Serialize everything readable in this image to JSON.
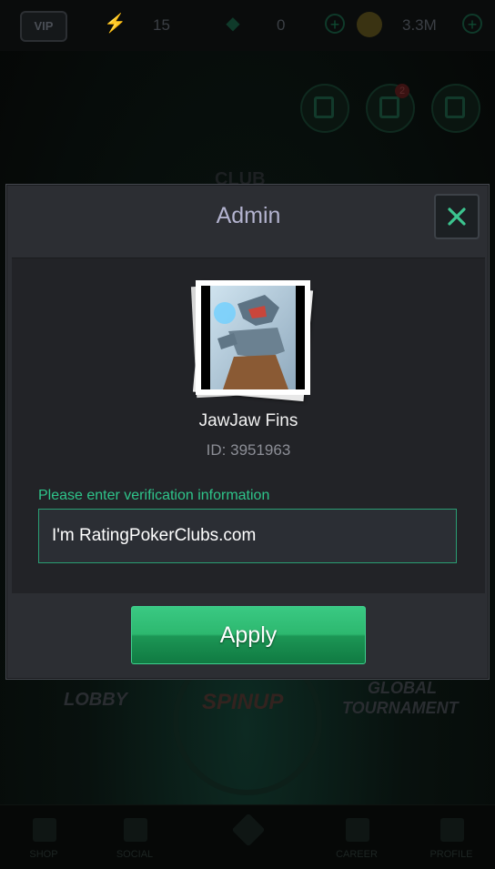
{
  "background": {
    "vip_label": "VIP",
    "energy_value": "15",
    "gems_value": "0",
    "coins_value": "3.3M",
    "notification_count": "2",
    "club_label": "CLUB",
    "lobby_label": "LOBBY",
    "spinup_label": "SPINUP",
    "global_label": "GLOBAL",
    "tournament_label": "TOURNAMENT",
    "nav": [
      "SHOP",
      "SOCIAL",
      "",
      "CAREER",
      "PROFILE"
    ]
  },
  "dialog": {
    "title": "Admin",
    "close_icon": "close-icon",
    "player": {
      "name": "JawJaw Fins",
      "id_text": "ID: 3951963"
    },
    "verification": {
      "label": "Please enter verification information",
      "value": "I'm RatingPokerClubs.com"
    },
    "apply_label": "Apply"
  },
  "colors": {
    "accent_green": "#2ec48a",
    "button_green": "#1c9655",
    "dialog_bg": "#2c2e33",
    "title_color": "#b3b3cf"
  }
}
